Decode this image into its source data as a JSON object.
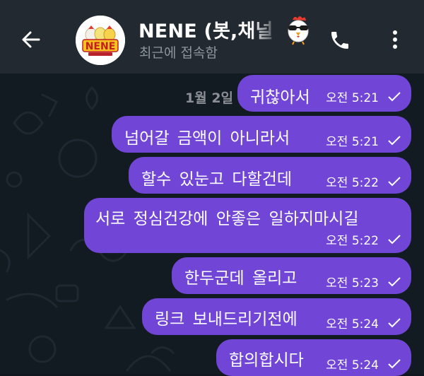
{
  "header": {
    "title": "NENE (봇,채널",
    "subtitle": "최근에 접속함",
    "avatar_logo_text": "NENE"
  },
  "chat": {
    "date_label": "1월 2일",
    "messages": [
      {
        "text": "귀찮아서",
        "time": "오전 5:21"
      },
      {
        "text": "넘어갈 금액이 아니라서",
        "time": "오전 5:21"
      },
      {
        "text": "할수 있눈고 다할건데",
        "time": "오전 5:22"
      },
      {
        "text": "서로 정심건강에 안좋은 일하지마시길",
        "time": "오전 5:22"
      },
      {
        "text": "한두군데 올리고",
        "time": "오전 5:23"
      },
      {
        "text": "링크 보내드리기전에",
        "time": "오전 5:24"
      },
      {
        "text": "합의합시다",
        "time": "오전 5:24"
      }
    ]
  },
  "icons": {
    "back": "arrow-left-icon",
    "call": "phone-icon",
    "menu": "more-vertical-icon",
    "read": "check-icon",
    "emoji": "chicken-sunglasses-emoji-icon"
  },
  "colors": {
    "header_bg": "#222930",
    "chat_bg": "#121a22",
    "bubble": "#7145d6",
    "subtitle": "#8c969f"
  }
}
